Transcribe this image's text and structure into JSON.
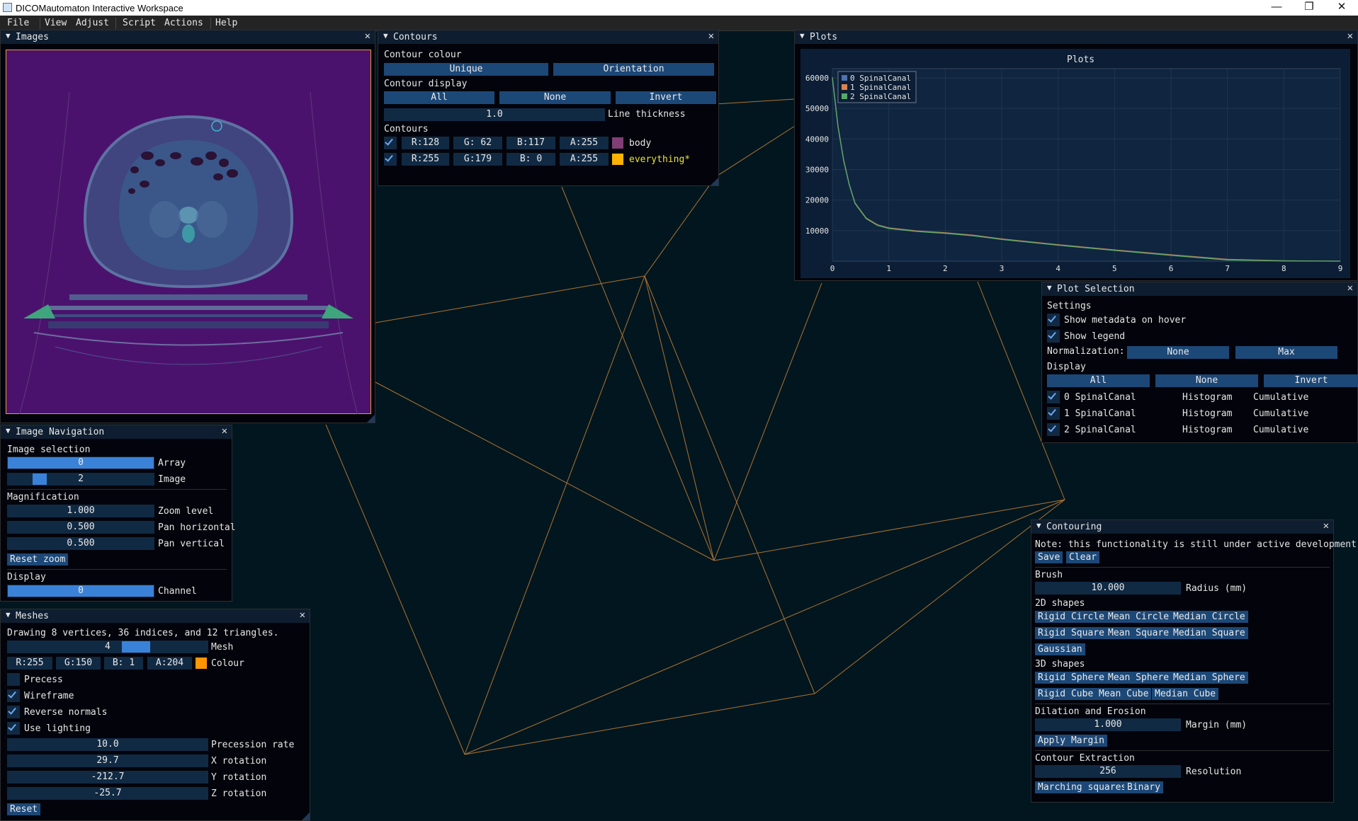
{
  "window": {
    "title": "DICOMautomaton Interactive Workspace",
    "controls": {
      "minimize": "—",
      "maximize": "❐",
      "close": "✕"
    }
  },
  "menubar": {
    "items": [
      "File",
      "View",
      "Adjust",
      "Script",
      "Actions",
      "Help"
    ]
  },
  "images_window": {
    "title": "Images"
  },
  "contours_window": {
    "title": "Contours",
    "colour_label": "Contour colour",
    "unique_btn": "Unique",
    "orientation_btn": "Orientation",
    "display_label": "Contour display",
    "all_btn": "All",
    "none_btn": "None",
    "invert_btn": "Invert",
    "line_thickness_value": "1.0",
    "line_thickness_label": "Line thickness",
    "contours_label": "Contours",
    "rows": [
      {
        "r": "R:128",
        "g": "G: 62",
        "b": "B:117",
        "a": "A:255",
        "swatch": "#80 3e75",
        "color": "#803e75",
        "name": "body",
        "name_color": "#e6e6e6"
      },
      {
        "r": "R:255",
        "g": "G:179",
        "b": "B:  0",
        "a": "A:255",
        "color": "#ffb300",
        "name": "everything*",
        "name_color": "#e8e23a"
      }
    ]
  },
  "plots_window": {
    "title": "Plots"
  },
  "chart_data": {
    "type": "line",
    "title": "Plots",
    "xlim": [
      0,
      9
    ],
    "ylim": [
      0,
      63000
    ],
    "x_ticks": [
      0,
      1,
      2,
      3,
      4,
      5,
      6,
      7,
      8,
      9
    ],
    "y_ticks": [
      10000,
      20000,
      30000,
      40000,
      50000,
      60000
    ],
    "grid": true,
    "legend_position": "top-left",
    "series": [
      {
        "name": "0 SpinalCanal",
        "color": "#4c72b0",
        "x": [
          0,
          0.1,
          0.2,
          0.3,
          0.4,
          0.6,
          0.8,
          1,
          1.5,
          2,
          2.5,
          3,
          4,
          5,
          6,
          7,
          8,
          9
        ],
        "y": [
          60000,
          44000,
          33000,
          25000,
          19000,
          14000,
          11800,
          10800,
          9800,
          9200,
          8400,
          7200,
          5300,
          3600,
          2000,
          500,
          100,
          0
        ]
      },
      {
        "name": "1 SpinalCanal",
        "color": "#dd8452",
        "x": [
          0,
          0.1,
          0.2,
          0.3,
          0.4,
          0.6,
          0.8,
          1,
          1.5,
          2,
          2.5,
          3,
          4,
          5,
          6,
          7,
          8,
          9
        ],
        "y": [
          60200,
          44200,
          33200,
          25100,
          19100,
          14100,
          11900,
          10900,
          9900,
          9300,
          8500,
          7300,
          5400,
          3700,
          2100,
          600,
          150,
          0
        ]
      },
      {
        "name": "2 SpinalCanal",
        "color": "#55a868",
        "x": [
          0,
          0.1,
          0.2,
          0.3,
          0.4,
          0.6,
          0.8,
          1,
          1.5,
          2,
          2.5,
          3,
          4,
          5,
          6,
          7,
          8,
          9
        ],
        "y": [
          59900,
          43900,
          32900,
          24900,
          18900,
          13900,
          11700,
          10700,
          9700,
          9100,
          8300,
          7100,
          5200,
          3500,
          1900,
          400,
          80,
          0
        ]
      }
    ]
  },
  "plot_selection": {
    "title": "Plot Selection",
    "settings_label": "Settings",
    "show_metadata": "Show metadata on hover",
    "show_legend": "Show legend",
    "normalization_label": "Normalization:",
    "norm_none": "None",
    "norm_max": "Max",
    "display_label": "Display",
    "all_btn": "All",
    "none_btn": "None",
    "invert_btn": "Invert",
    "rows": [
      {
        "name": "0 SpinalCanal",
        "hist": "Histogram",
        "cum": "Cumulative"
      },
      {
        "name": "1 SpinalCanal",
        "hist": "Histogram",
        "cum": "Cumulative"
      },
      {
        "name": "2 SpinalCanal",
        "hist": "Histogram",
        "cum": "Cumulative"
      }
    ]
  },
  "image_navigation": {
    "title": "Image Navigation",
    "selection_label": "Image selection",
    "array_value": "0",
    "array_label": "Array",
    "image_value": "2",
    "image_label": "Image",
    "image_fraction": 0.25,
    "magnification_label": "Magnification",
    "zoom_value": "1.000",
    "zoom_label": "Zoom level",
    "pan_h_value": "0.500",
    "pan_h_label": "Pan horizontal",
    "pan_v_value": "0.500",
    "pan_v_label": "Pan vertical",
    "reset_zoom": "Reset zoom",
    "display_label": "Display",
    "channel_value": "0",
    "channel_label": "Channel"
  },
  "meshes": {
    "title": "Meshes",
    "info": "Drawing 8 vertices, 36 indices, and 12 triangles.",
    "mesh_value": "4",
    "mesh_label": "Mesh",
    "r": "R:255",
    "g": "G:150",
    "b": "B:  1",
    "a": "A:204",
    "colour": "#ff9601",
    "colour_label": "Colour",
    "precess": "Precess",
    "wireframe": "Wireframe",
    "reverse_normals": "Reverse normals",
    "use_lighting": "Use lighting",
    "precession_value": "10.0",
    "precession_label": "Precession rate",
    "x_rot_value": "29.7",
    "x_rot_label": "X rotation",
    "y_rot_value": "-212.7",
    "y_rot_label": "Y rotation",
    "z_rot_value": "-25.7",
    "z_rot_label": "Z rotation",
    "reset": "Reset"
  },
  "contouring": {
    "title": "Contouring",
    "note": "Note: this functionality is still under active development.",
    "save": "Save",
    "clear": "Clear",
    "brush_label": "Brush",
    "radius_value": "10.000",
    "radius_label": "Radius (mm)",
    "shapes2d_label": "2D shapes",
    "rigid_circle": "Rigid Circle",
    "mean_circle": "Mean Circle",
    "median_circle": "Median Circle",
    "rigid_square": "Rigid Square",
    "mean_square": "Mean Square",
    "median_square": "Median Square",
    "gaussian": "Gaussian",
    "shapes3d_label": "3D shapes",
    "rigid_sphere": "Rigid Sphere",
    "mean_sphere": "Mean Sphere",
    "median_sphere": "Median Sphere",
    "rigid_cube": "Rigid Cube",
    "mean_cube": "Mean Cube",
    "median_cube": "Median Cube",
    "dilation_label": "Dilation and Erosion",
    "margin_value": "1.000",
    "margin_label": "Margin (mm)",
    "apply_margin": "Apply Margin",
    "extraction_label": "Contour Extraction",
    "resolution_value": "256",
    "resolution_label": "Resolution",
    "marching_squares": "Marching squares",
    "binary": "Binary"
  },
  "colors": {
    "accent": "#3a82d8",
    "title_bar": "#0e1e30",
    "button": "#1c4877",
    "wireframe": "#b87a2e",
    "background": "#021620"
  }
}
